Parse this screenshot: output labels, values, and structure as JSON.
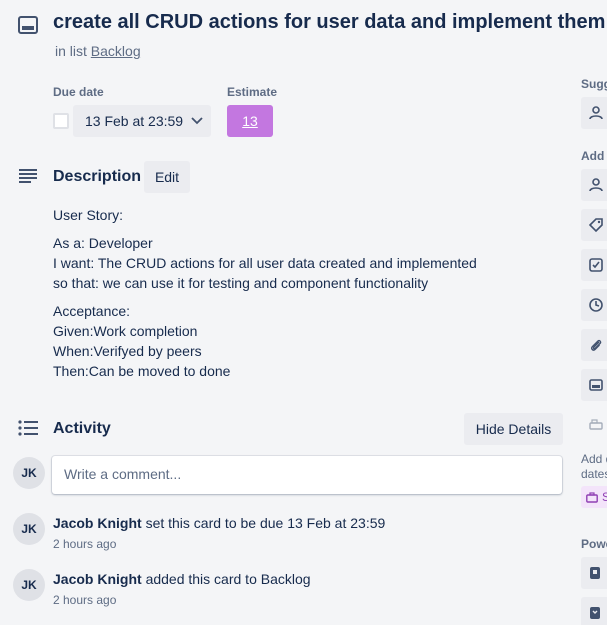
{
  "card": {
    "title": "create all CRUD actions for user data and implement them",
    "in_list_prefix": "in list",
    "list_name": "Backlog"
  },
  "due_date": {
    "label": "Due date",
    "value": "13 Feb at 23:59"
  },
  "estimate": {
    "label": "Estimate",
    "value": "13",
    "color": "#c377e0"
  },
  "description": {
    "title": "Description",
    "edit_label": "Edit",
    "paragraphs": [
      [
        "User Story:"
      ],
      [
        "As a: Developer",
        "I want: The CRUD actions for all user data created and implemented",
        "so that: we can use it for testing and component functionality"
      ],
      [
        "Acceptance:",
        "Given:Work completion",
        "When:Verifyed by peers",
        "Then:Can be moved to done"
      ]
    ]
  },
  "activity": {
    "title": "Activity",
    "hide_details_label": "Hide Details",
    "comment_placeholder": "Write a comment...",
    "current_user_initials": "JK",
    "entries": [
      {
        "initials": "JK",
        "user": "Jacob Knight",
        "action": "set this card to be due 13 Feb at 23:59",
        "time": "2 hours ago"
      },
      {
        "initials": "JK",
        "user": "Jacob Knight",
        "action": "added this card to Backlog",
        "time": "2 hours ago"
      }
    ]
  },
  "sidebar": {
    "suggested_label": "Sugg",
    "add_label": "Add",
    "add_dates_text_1": "Add d",
    "add_dates_text_2": "dates",
    "power_label": "Powe",
    "icons": [
      "person-icon",
      "person-icon",
      "tag-icon",
      "checklist-icon",
      "clock-icon",
      "paperclip-icon",
      "card-cover-icon",
      "custom-fields-icon",
      "power-up-icon",
      "power-up-icon"
    ],
    "badge_text": "S"
  }
}
